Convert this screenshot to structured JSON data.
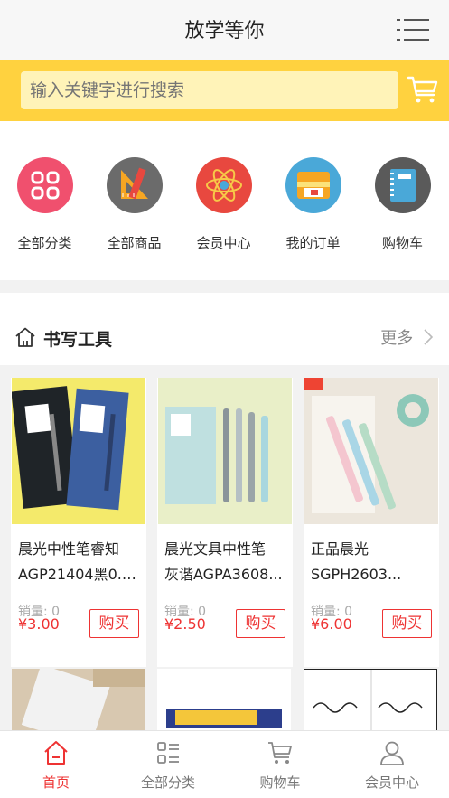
{
  "header": {
    "title": "放学等你"
  },
  "search": {
    "placeholder": "输入关键字进行搜索"
  },
  "quick_nav": [
    {
      "label": "全部分类",
      "icon": "category-grid-icon",
      "color": "#f0506e"
    },
    {
      "label": "全部商品",
      "icon": "ruler-triangle-icon",
      "color": "#6b6b6b"
    },
    {
      "label": "会员中心",
      "icon": "atom-icon",
      "color": "#e8483f"
    },
    {
      "label": "我的订单",
      "icon": "pencil-case-icon",
      "color": "#4aa8d8"
    },
    {
      "label": "购物车",
      "icon": "notebook-icon",
      "color": "#5a5a5a"
    }
  ],
  "section": {
    "title": "书写工具",
    "more": "更多"
  },
  "products": [
    {
      "name_line1": "晨光中性笔睿知",
      "name_line2": "AGP21404黑0.5...",
      "sales": "销量: 0",
      "price": "¥3.00",
      "buy": "购买"
    },
    {
      "name_line1": "晨光文具中性笔",
      "name_line2": "灰谐AGPA3608...",
      "sales": "销量: 0",
      "price": "¥2.50",
      "buy": "购买"
    },
    {
      "name_line1": "正品晨光",
      "name_line2": "SGPH2603...",
      "sales": "销量: 0",
      "price": "¥6.00",
      "buy": "购买"
    }
  ],
  "tabbar": [
    {
      "label": "首页",
      "icon": "home-icon",
      "active": true
    },
    {
      "label": "全部分类",
      "icon": "category-list-icon",
      "active": false
    },
    {
      "label": "购物车",
      "icon": "cart-icon",
      "active": false
    },
    {
      "label": "会员中心",
      "icon": "user-icon",
      "active": false
    }
  ],
  "colors": {
    "accent": "#e33333",
    "search_bar": "#ffd23f"
  }
}
